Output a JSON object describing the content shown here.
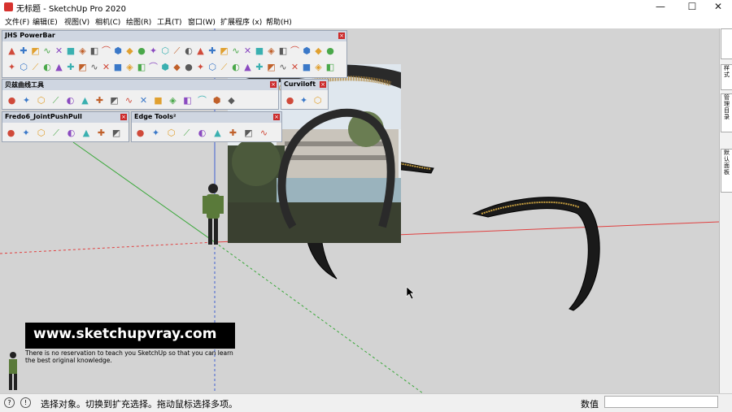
{
  "window": {
    "title": "无标题 - SketchUp Pro 2020",
    "minimize": "—",
    "maximize": "☐",
    "close": "✕"
  },
  "menubar": {
    "items": [
      "文件(F)",
      "编辑(E)",
      "视图(V)",
      "相机(C)",
      "绘图(R)",
      "工具(T)",
      "窗口(W)",
      "扩展程序 (x)",
      "帮助(H)"
    ]
  },
  "toolbars": {
    "jhs": {
      "title": "JHS PowerBar",
      "close": "×"
    },
    "bezier": {
      "title": "贝兹曲线工具",
      "close": "×"
    },
    "curviloft": {
      "title": "Curviloft",
      "close": "×"
    },
    "fredo": {
      "title": "Fredo6_JointPushPull",
      "close": "×"
    },
    "edge": {
      "title": "Edge Tools²",
      "close": "×"
    }
  },
  "right_panel": {
    "tabs": [
      "样式",
      "管理目录",
      "默认面板"
    ]
  },
  "watermark": {
    "url": "www.sketchupvray.com",
    "subtext": "There is no reservation to teach you SketchUp so that you can learn the best original knowledge."
  },
  "statusbar": {
    "message": "选择对象。切换到扩充选择。拖动鼠标选择多项。",
    "measurement_label": "数值",
    "measurement_value": ""
  },
  "colors": {
    "red_axis": "#e04040",
    "green_axis": "#3aa83a",
    "blue_axis": "#4060d0",
    "viewport_bg": "#d3d3d3"
  }
}
